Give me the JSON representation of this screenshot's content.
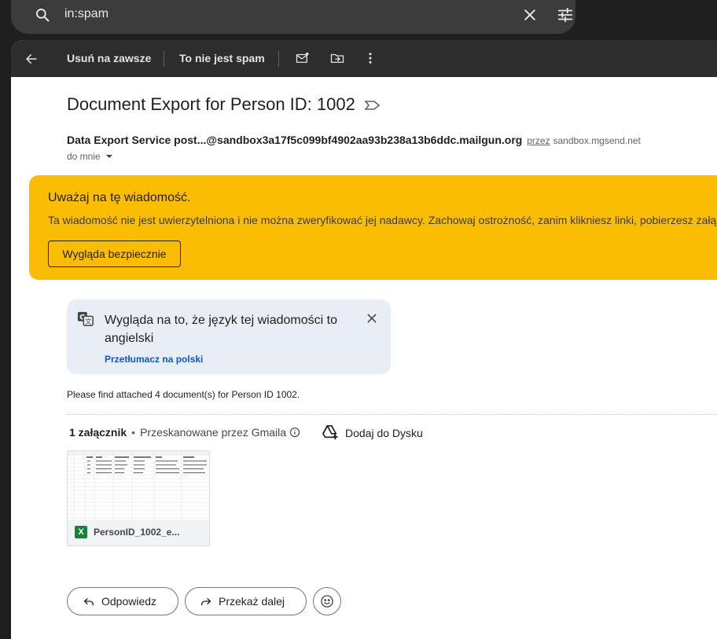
{
  "search": {
    "query": "in:spam"
  },
  "toolbar": {
    "delete_forever_label": "Usuń na zawsze",
    "not_spam_label": "To nie jest spam"
  },
  "email": {
    "subject": "Document Export for Person ID: 1002",
    "sender": "Data Export Service post...@sandbox3a17f5c099bf4902aa93b238a13b6ddc.mailgun.org",
    "via_label": "przez",
    "via_domain": "sandbox.mgsend.net",
    "to_label": "do mnie",
    "body": "Please find attached 4 document(s) for Person ID 1002."
  },
  "warning": {
    "title": "Uważaj na tę wiadomość.",
    "text": "Ta wiadomość nie jest uwierzytelniona i nie można zweryfikować jej nadawcy. Zachowaj ostrożność, zanim klikniesz linki, pobierzesz załączniki",
    "button_label": "Wygląda bezpiecznie"
  },
  "translate": {
    "text": "Wygląda na to, że język tej wiadomości to angielski",
    "link_label": "Przetłumacz na polski"
  },
  "attachments": {
    "count_label": "1 załącznik",
    "scan_label": "Przeskanowane przez Gmaila",
    "add_to_drive_label": "Dodaj do Dysku",
    "file_name": "PersonID_1002_e...",
    "file_icon_letter": "X"
  },
  "actions": {
    "reply_label": "Odpowiedz",
    "forward_label": "Przekaż dalej"
  },
  "colors": {
    "warning_bg": "#fbbc04",
    "translate_bg": "#e9eef6",
    "link": "#0b57d0",
    "excel_green": "#188038"
  }
}
